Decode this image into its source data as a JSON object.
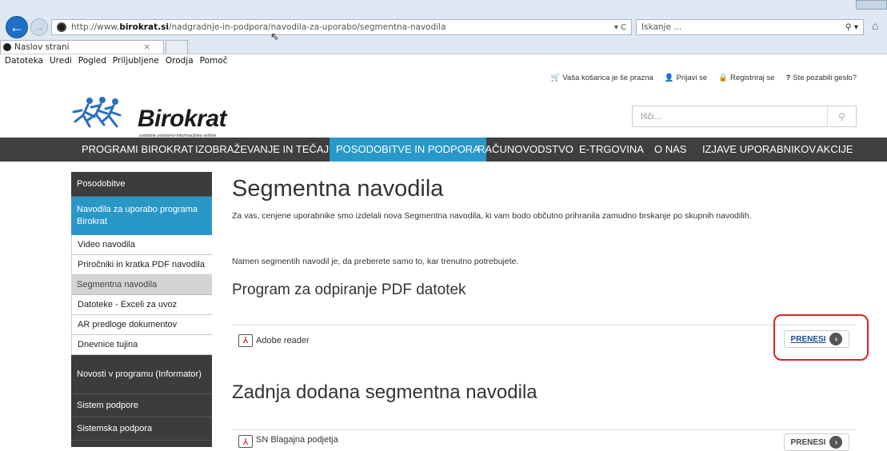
{
  "browser": {
    "url_prefix": "http://www.",
    "url_host": "birokrat.si",
    "url_path": "/nadgradnje-in-podpora/navodila-za-uporabo/segmentna-navodila",
    "address_tools": "▾ C",
    "search_placeholder": "Iskanje ...",
    "tab_title": "Naslov strani",
    "tab_close": "×",
    "menu": [
      "Datoteka",
      "Uredi",
      "Pogled",
      "Priljubljene",
      "Orodja",
      "Pomoč"
    ]
  },
  "topbar": {
    "cart": "Vaša košarica je še prazna",
    "login": "Prijavi se",
    "register": "Registriraj se",
    "forgot": "Ste pozabili geslo?"
  },
  "logo": {
    "brand": "Birokrat",
    "tagline": "sodobne poslovno-informacijske rešitve"
  },
  "site_search": {
    "placeholder": "Išči..."
  },
  "mainnav": [
    "PROGRAMI BIROKRAT",
    "IZOBRAŽEVANJE IN TEČAJI",
    "POSODOBITVE IN PODPORA",
    "RAČUNOVODSTVO",
    "E-TRGOVINA",
    "O NAS",
    "IZJAVE UPORABNIKOV",
    "AKCIJE"
  ],
  "sidebar": [
    "Posodobitve",
    "Navodila za uporabo programa Birokrat",
    "Video navodila",
    "Priročniki in kratka PDF navodila",
    "Segmentna navodila",
    "Datoteke - Exceli za uvoz",
    "AR predloge dokumentov",
    "Dnevnice tujina",
    "Novosti v programu (Informator)",
    "Sistem podpore",
    "Sistemska podpora"
  ],
  "content": {
    "title": "Segmentna navodila",
    "intro": "Za vas, cenjene uporabnike smo izdelali nova Segmentna navodila, ki vam bodo občutno prihranila zamudno brskanje po skupnih navodilih.",
    "purpose": "Namen segmentih navodil je, da preberete samo to, kar trenutno potrebujete.",
    "section1": "Program za odpiranje PDF datotek",
    "item1": "Adobe reader",
    "section2": "Zadnja dodana segmentna navodila",
    "item2": "SN Blagajna podjetja",
    "download_label": "PRENESI"
  }
}
